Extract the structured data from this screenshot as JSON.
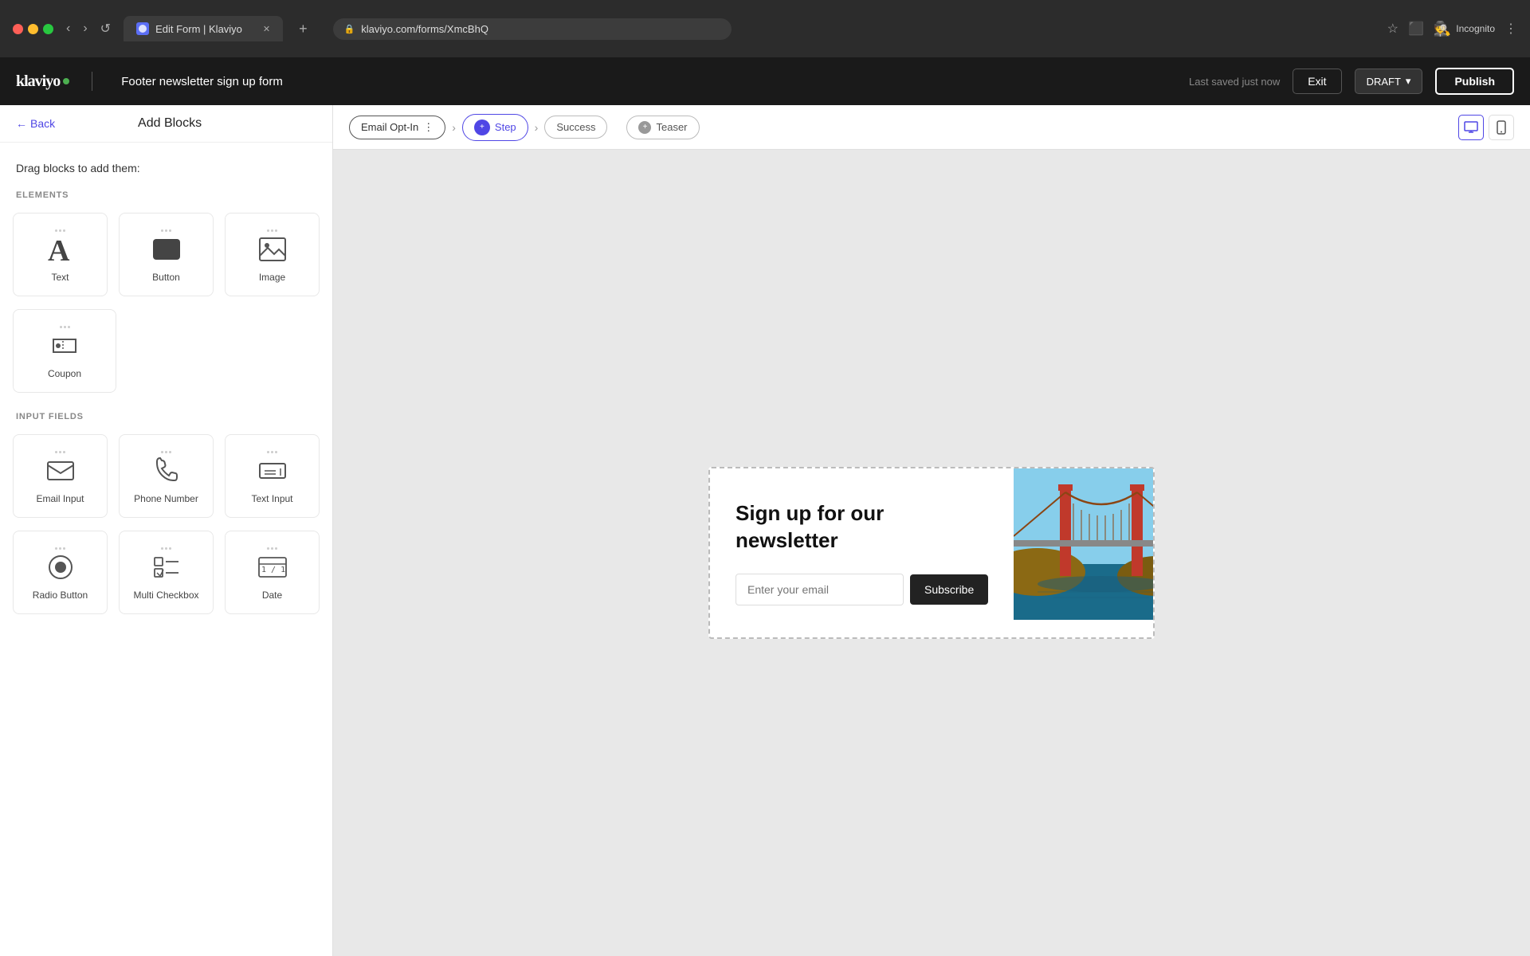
{
  "browser": {
    "tab_title": "Edit Form | Klaviyo",
    "url": "klaviyo.com/forms/XmcBhQ",
    "new_tab_label": "+",
    "nav_back": "‹",
    "nav_forward": "›",
    "nav_refresh": "↺",
    "incognito_label": "Incognito",
    "bookmark_icon": "★",
    "extensions_icon": "⬛",
    "menu_icon": "⋮"
  },
  "header": {
    "logo": "klaviyo",
    "form_title": "Footer newsletter sign up form",
    "last_saved": "Last saved just now",
    "exit_label": "Exit",
    "draft_label": "DRAFT",
    "publish_label": "Publish"
  },
  "sidebar": {
    "back_label": "Back",
    "add_blocks_title": "Add Blocks",
    "drag_instruction": "Drag blocks to add them:",
    "elements_label": "ELEMENTS",
    "input_fields_label": "INPUT FIELDS",
    "elements": [
      {
        "id": "text",
        "label": "Text",
        "icon": "A"
      },
      {
        "id": "button",
        "label": "Button",
        "icon": "btn"
      },
      {
        "id": "image",
        "label": "Image",
        "icon": "img"
      },
      {
        "id": "coupon",
        "label": "Coupon",
        "icon": "coupon"
      }
    ],
    "input_fields": [
      {
        "id": "email-input",
        "label": "Email Input",
        "icon": "email"
      },
      {
        "id": "phone-number",
        "label": "Phone Number",
        "icon": "phone"
      },
      {
        "id": "text-input",
        "label": "Text Input",
        "icon": "textinput"
      },
      {
        "id": "radio-button",
        "label": "Radio Button",
        "icon": "radio"
      },
      {
        "id": "multi-checkbox",
        "label": "Multi Checkbox",
        "icon": "checkbox"
      },
      {
        "id": "date",
        "label": "Date",
        "icon": "date"
      }
    ]
  },
  "stepbar": {
    "email_opt_in": "Email Opt-In",
    "step_label": "Step",
    "success_label": "Success",
    "teaser_label": "Teaser",
    "desktop_icon": "🖥",
    "mobile_icon": "📱"
  },
  "form_preview": {
    "headline": "Sign up for our newsletter",
    "email_placeholder": "Enter your email",
    "subscribe_label": "Subscribe"
  }
}
